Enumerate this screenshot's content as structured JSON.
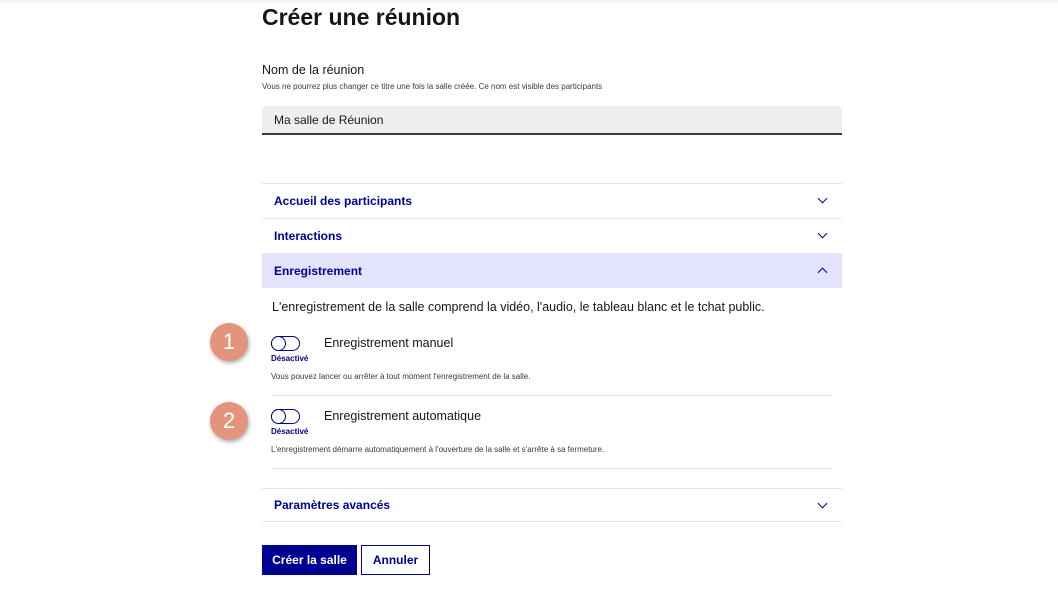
{
  "page": {
    "title": "Créer une réunion"
  },
  "name_field": {
    "label": "Nom de la réunion",
    "hint": "Vous ne pourrez plus changer ce titre une fois la salle créée. Ce nom est visible des participants",
    "value": "Ma salle de Réunion"
  },
  "accordion": {
    "welcome": {
      "label": "Accueil des participants",
      "expanded": false
    },
    "interactions": {
      "label": "Interactions",
      "expanded": false
    },
    "recording": {
      "label": "Enregistrement",
      "expanded": true,
      "intro": "L'enregistrement de la salle comprend la vidéo, l'audio, le tableau blanc et le tchat public.",
      "manual": {
        "title": "Enregistrement manuel",
        "state": "Désactivé",
        "enabled": false,
        "description": "Vous pouvez lancer ou arrêter à tout moment l'enregistrement de la salle."
      },
      "automatic": {
        "title": "Enregistrement automatique",
        "state": "Désactivé",
        "enabled": false,
        "description": "L'enregistrement démarre automatiquement à l'ouverture de la salle et s'arrête à sa fermeture."
      }
    },
    "advanced": {
      "label": "Paramètres avancés",
      "expanded": false
    }
  },
  "actions": {
    "create_label": "Créer la salle",
    "cancel_label": "Annuler"
  },
  "badges": {
    "first": "1",
    "second": "2"
  },
  "colors": {
    "primary": "#000091",
    "open_section_bg": "#e3e3fd",
    "badge": "#e4937d"
  }
}
